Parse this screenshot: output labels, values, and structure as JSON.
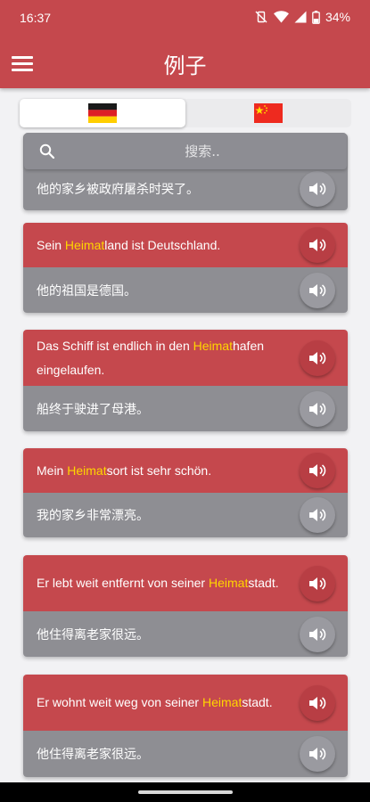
{
  "status": {
    "time": "16:37",
    "battery": "34%"
  },
  "header": {
    "title": "例子",
    "menu_icon": "hamburger-menu-icon"
  },
  "languages": [
    {
      "code": "de",
      "icon": "german-flag-icon",
      "active": true
    },
    {
      "code": "zh",
      "icon": "chinese-flag-icon",
      "active": false
    }
  ],
  "search": {
    "placeholder": "搜索.."
  },
  "colors": {
    "accent": "#c5484d",
    "highlight": "#ffd600",
    "secondary": "#8e8e93"
  },
  "examples": [
    {
      "de": [],
      "zh": "他的家乡被政府屠杀时哭了。"
    },
    {
      "de": [
        {
          "text": "Sein "
        },
        {
          "text": "Heimat",
          "hl": true
        },
        {
          "text": "land ist Deutschland."
        }
      ],
      "zh": "他的祖国是德国。"
    },
    {
      "de": [
        {
          "text": "Das Schiff ist endlich in den "
        },
        {
          "text": "Heimat",
          "hl": true
        },
        {
          "text": "hafen eingelaufen."
        }
      ],
      "zh": "船终于驶进了母港。"
    },
    {
      "de": [
        {
          "text": "Mein "
        },
        {
          "text": "Heimat",
          "hl": true
        },
        {
          "text": "sort ist sehr schön."
        }
      ],
      "zh": "我的家乡非常漂亮。"
    },
    {
      "de": [
        {
          "text": "Er lebt weit entfernt von seiner "
        },
        {
          "text": "Heimat",
          "hl": true
        },
        {
          "text": "stadt."
        }
      ],
      "zh": "他住得离老家很远。"
    },
    {
      "de": [
        {
          "text": "Er wohnt weit weg von seiner "
        },
        {
          "text": "Heimat",
          "hl": true
        },
        {
          "text": "stadt."
        }
      ],
      "zh": "他住得离老家很远。"
    }
  ]
}
